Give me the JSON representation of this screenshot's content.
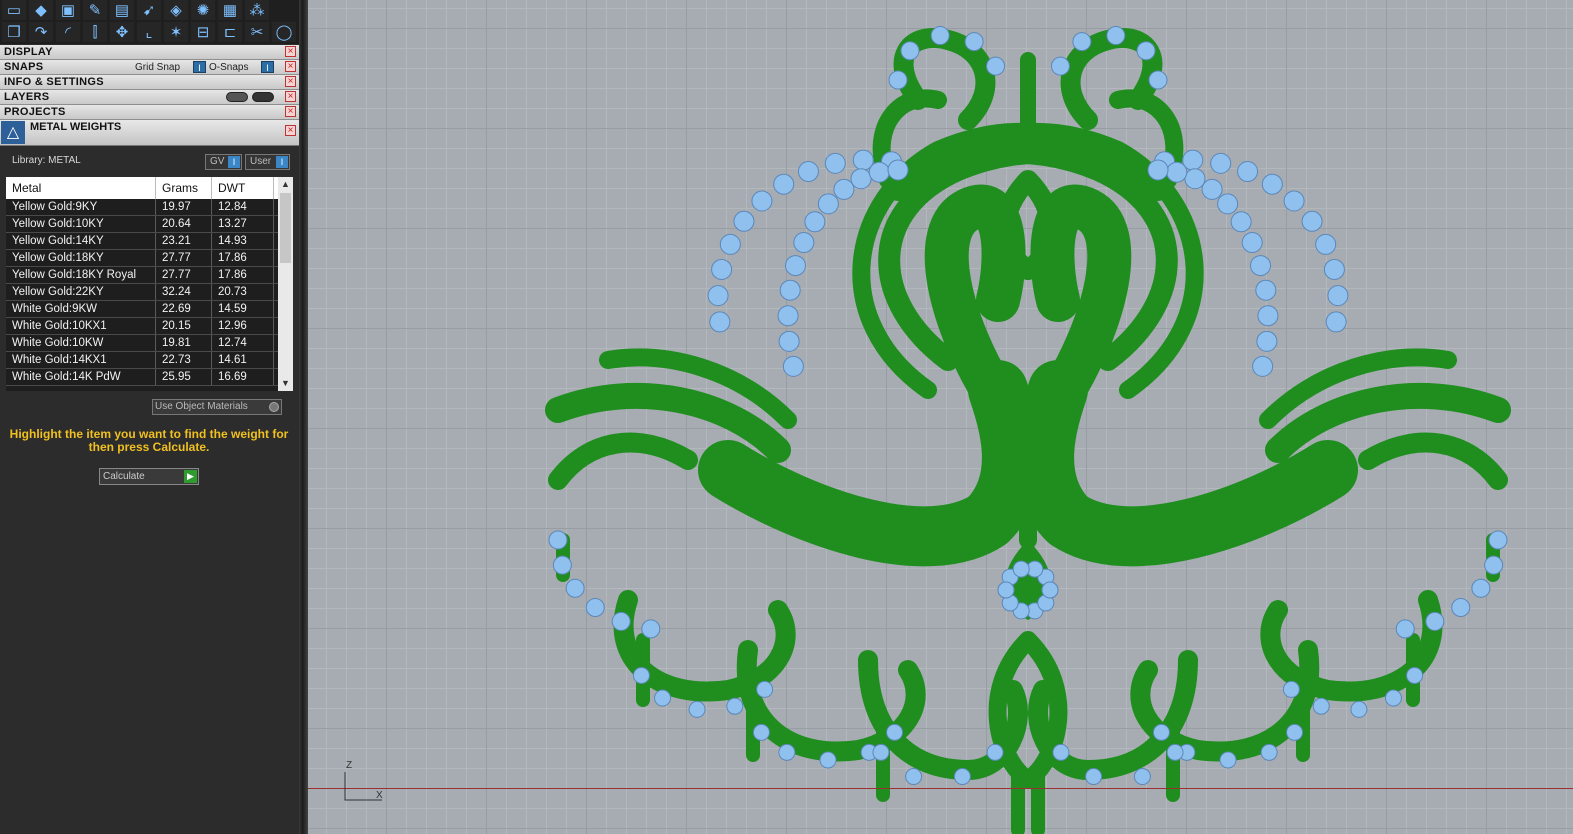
{
  "toolbar": {
    "row1_icons": [
      "plane-icon",
      "diamond-icon",
      "box-icon",
      "brush-icon",
      "document-icon",
      "arrow-icon",
      "gem-icon",
      "sun-icon",
      "grid-icon",
      "cluster-icon"
    ],
    "row2_icons": [
      "cubes-icon",
      "curve-icon",
      "arc-icon",
      "pipe-icon",
      "move-icon",
      "corner-icon",
      "fan-icon",
      "link-icon",
      "bracket-icon",
      "scissors-icon",
      "ring-icon"
    ]
  },
  "panels": {
    "display": "DISPLAY",
    "snaps": "SNAPS",
    "grid_snap": "Grid Snap",
    "o_snaps": "O-Snaps",
    "info_settings": "INFO & SETTINGS",
    "layers": "LAYERS",
    "projects": "PROJECTS"
  },
  "metal_weights": {
    "title": "METAL WEIGHTS",
    "library_label": "Library: METAL",
    "gv_label": "GV",
    "user_label": "User",
    "columns": [
      "Metal",
      "Grams",
      "DWT"
    ],
    "rows": [
      [
        "Yellow Gold:9KY",
        "19.97",
        "12.84"
      ],
      [
        "Yellow Gold:10KY",
        "20.64",
        "13.27"
      ],
      [
        "Yellow Gold:14KY",
        "23.21",
        "14.93"
      ],
      [
        "Yellow Gold:18KY",
        "27.77",
        "17.86"
      ],
      [
        "Yellow Gold:18KY Royal",
        "27.77",
        "17.86"
      ],
      [
        "Yellow Gold:22KY",
        "32.24",
        "20.73"
      ],
      [
        "White Gold:9KW",
        "22.69",
        "14.59"
      ],
      [
        "White Gold:10KX1",
        "20.15",
        "12.96"
      ],
      [
        "White Gold:10KW",
        "19.81",
        "12.74"
      ],
      [
        "White Gold:14KX1",
        "22.73",
        "14.61"
      ],
      [
        "White Gold:14K PdW",
        "25.95",
        "16.69"
      ]
    ],
    "use_object_materials": "Use Object Materials",
    "hint": "Highlight the item you want to find the weight for then press Calculate.",
    "calculate": "Calculate"
  },
  "viewport": {
    "axis_z": "Z",
    "axis_x": "X",
    "model_color": "#1f8e1f",
    "gem_color": "#8fc0ee",
    "background": "#a6acb2"
  }
}
